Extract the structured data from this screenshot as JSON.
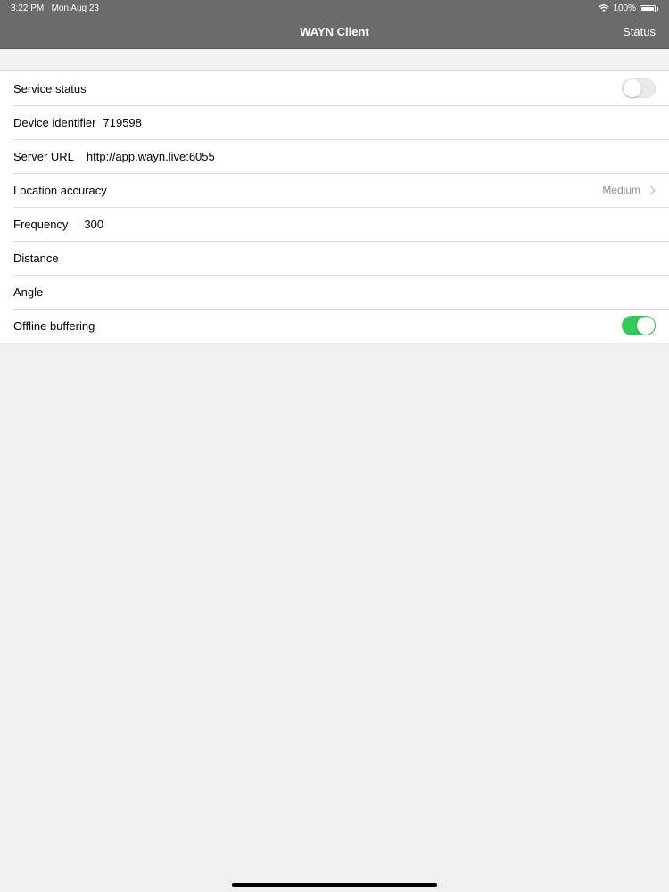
{
  "statusbar": {
    "time": "3:22 PM",
    "date": "Mon Aug 23",
    "battery": "100%",
    "wifi_icon": "wifi-icon",
    "battery_icon": "battery-icon"
  },
  "navbar": {
    "title": "WAYN Client",
    "right_button": "Status"
  },
  "settings": [
    {
      "label": "Service status",
      "type": "toggle",
      "on": false
    },
    {
      "label": "Device identifier",
      "value": "719598"
    },
    {
      "label": "Server URL",
      "value": "http://app.wayn.live:6055"
    },
    {
      "label": "Location accuracy",
      "detail": "Medium",
      "type": "disclosure"
    },
    {
      "label": "Frequency",
      "value": "300"
    },
    {
      "label": "Distance",
      "value": ""
    },
    {
      "label": "Angle",
      "value": ""
    },
    {
      "label": "Offline buffering",
      "type": "toggle",
      "on": true
    }
  ],
  "colors": {
    "nav_background": "#6b6b6b",
    "switch_on": "#34c759",
    "page_background": "#efeff4"
  }
}
